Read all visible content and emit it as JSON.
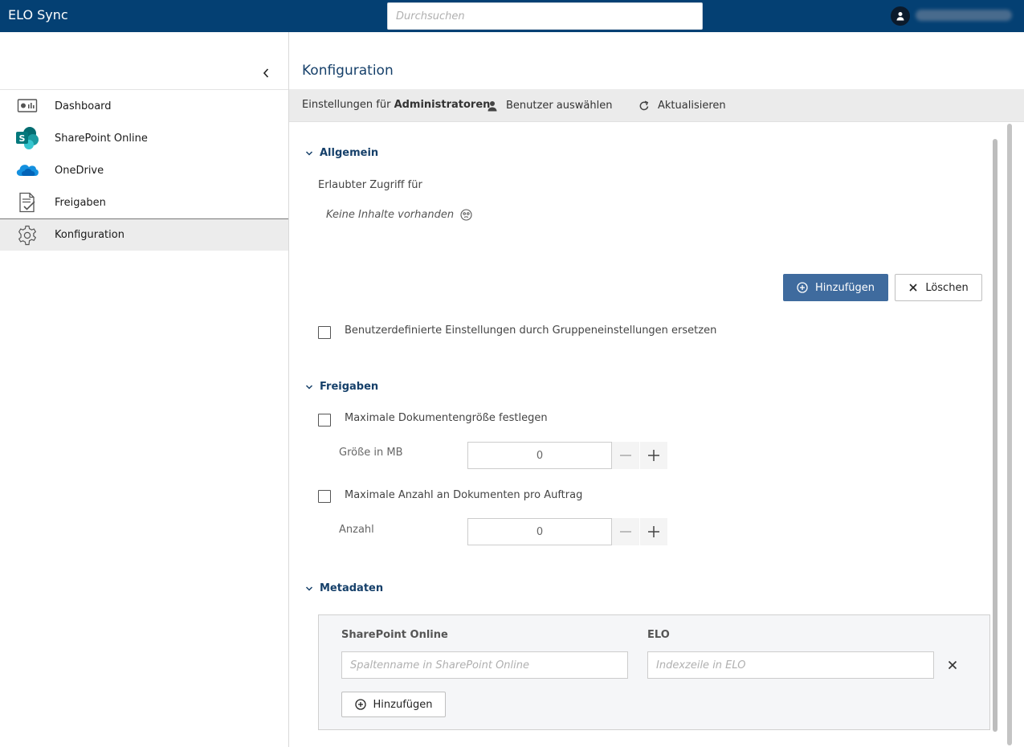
{
  "app": {
    "title": "ELO Sync"
  },
  "search": {
    "placeholder": "Durchsuchen"
  },
  "sidebar": {
    "items": [
      {
        "label": "Dashboard",
        "icon": "dashboard-icon"
      },
      {
        "label": "SharePoint Online",
        "icon": "sharepoint-icon"
      },
      {
        "label": "OneDrive",
        "icon": "onedrive-icon"
      },
      {
        "label": "Freigaben",
        "icon": "freigaben-icon"
      },
      {
        "label": "Konfiguration",
        "icon": "gear-icon",
        "active": true
      }
    ]
  },
  "main": {
    "title": "Konfiguration",
    "toolbar": {
      "settings_prefix": "Einstellungen für",
      "settings_target": "Administratoren",
      "select_user": "Benutzer auswählen",
      "refresh": "Aktualisieren"
    },
    "general": {
      "title": "Allgemein",
      "access_label": "Erlaubter Zugriff für",
      "empty_text": "Keine Inhalte vorhanden",
      "add_button": "Hinzufügen",
      "delete_button": "Löschen",
      "override_checkbox": "Benutzerdefinierte Einstellungen durch Gruppeneinstellungen ersetzen"
    },
    "releases": {
      "title": "Freigaben",
      "max_size_checkbox": "Maximale Dokumentengröße festlegen",
      "size_label": "Größe in MB",
      "size_value": "0",
      "max_count_checkbox": "Maximale Anzahl an Dokumenten pro Auftrag",
      "count_label": "Anzahl",
      "count_value": "0"
    },
    "metadata": {
      "title": "Metadaten",
      "col_sharepoint": "SharePoint Online",
      "col_elo": "ELO",
      "sharepoint_placeholder": "Spaltenname in SharePoint Online",
      "elo_placeholder": "Indexzeile in ELO",
      "add_button": "Hinzufügen"
    }
  },
  "colors": {
    "topbar": "#044073",
    "accent": "#16406a",
    "primary_button": "#3f6b9e"
  }
}
